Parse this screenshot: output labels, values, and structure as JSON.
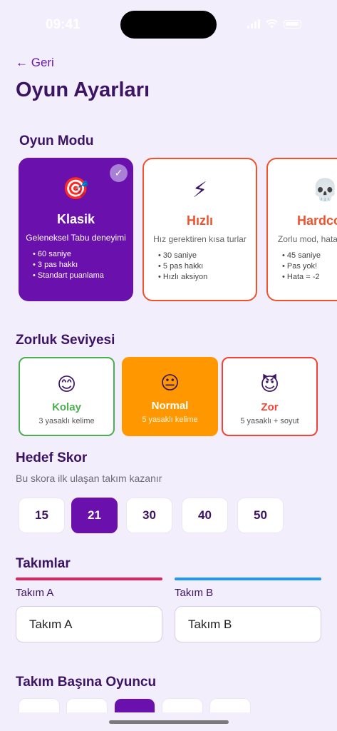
{
  "status": {
    "time": "09:41"
  },
  "nav": {
    "back_label": "← Geri"
  },
  "page": {
    "title": "Oyun Ayarları"
  },
  "mode_section": {
    "title": "Oyun Modu",
    "modes": [
      {
        "emoji": "🎯",
        "name": "Klasik",
        "desc": "Geleneksel Tabu deneyimi",
        "features": [
          "60 saniye",
          "3 pas hakkı",
          "Standart puanlama"
        ],
        "selected": true
      },
      {
        "emoji": "⚡",
        "name": "Hızlı",
        "desc": "Hız gerektiren kısa turlar",
        "features": [
          "30 saniye",
          "5 pas hakkı",
          "Hızlı aksiyon"
        ],
        "selected": false
      },
      {
        "emoji": "💀",
        "name": "Hardcore",
        "desc": "Zorlu mod, hata affetmez",
        "features": [
          "45 saniye",
          "Pas yok!",
          "Hata = -2"
        ],
        "selected": false
      }
    ],
    "check_mark": "✓"
  },
  "difficulty_section": {
    "title": "Zorluk Seviyesi",
    "levels": [
      {
        "emoji": "😊",
        "name": "Kolay",
        "sub": "3 yasaklı kelime",
        "color": "#4caf50"
      },
      {
        "emoji": "😐",
        "name": "Normal",
        "sub": "5 yasaklı kelime",
        "color": "#ff9800"
      },
      {
        "emoji": "😈",
        "name": "Zor",
        "sub": "5 yasaklı + soyut",
        "color": "#f44336"
      }
    ]
  },
  "score_section": {
    "title": "Hedef Skor",
    "subtitle": "Bu skora ilk ulaşan takım kazanır",
    "options": [
      "15",
      "21",
      "30",
      "40",
      "50"
    ],
    "selected": "21"
  },
  "teams_section": {
    "title": "Takımlar",
    "team_a": {
      "label": "Takım A",
      "value": "Takım A",
      "color": "#e0245e"
    },
    "team_b": {
      "label": "Takım B",
      "value": "Takım B",
      "color": "#2196f3"
    }
  },
  "players_section": {
    "title": "Takım Başına Oyuncu"
  },
  "colors": {
    "accent": "#6a10ad",
    "background": "#f3eefb",
    "title": "#3b1463"
  }
}
